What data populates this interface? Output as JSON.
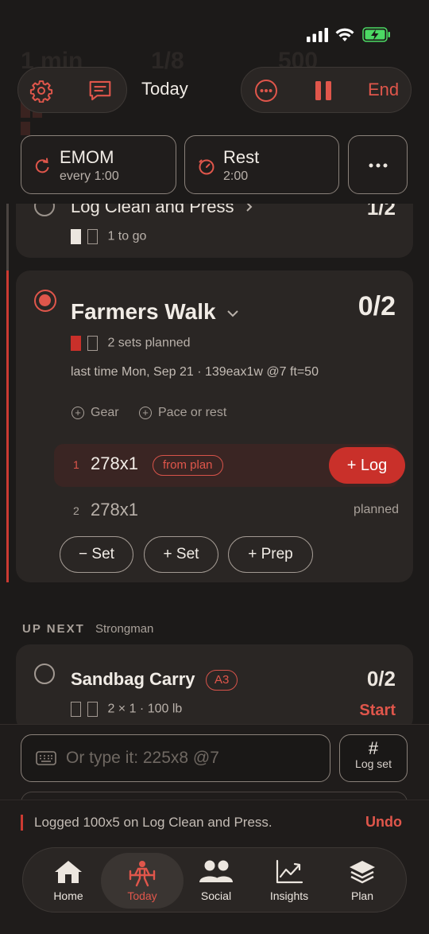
{
  "header": {
    "title": "Today",
    "end_label": "End"
  },
  "chips": {
    "emom": {
      "label": "EMOM",
      "sub": "every 1:00"
    },
    "rest": {
      "label": "Rest",
      "sub": "2:00"
    }
  },
  "previous_exercise": {
    "name": "Log Clean and Press",
    "count": "1/2",
    "sets_text": "1 to go"
  },
  "current_exercise": {
    "name": "Farmers Walk",
    "count": "0/2",
    "sets_text": "2 sets planned",
    "last_time": "last time Mon, Sep 21 · 139eax1w @7 ft=50",
    "options": [
      "Gear",
      "Pace or rest"
    ],
    "sets": [
      {
        "num": "1",
        "value": "278x1",
        "badge": "from plan",
        "action": "+ Log"
      },
      {
        "num": "2",
        "value": "278x1",
        "status": "planned"
      }
    ],
    "buttons": {
      "minus_set": "− Set",
      "plus_set": "+ Set",
      "plus_prep": "+ Prep"
    }
  },
  "up_next": {
    "heading": "UP NEXT",
    "group": "Strongman",
    "exercise": {
      "name": "Sandbag Carry",
      "tag": "A3",
      "count": "0/2",
      "meta": "2 × 1 · 100 lb",
      "action": "Start"
    }
  },
  "entry": {
    "placeholder": "Or type it: 225x8 @7",
    "log_set_symbol": "#",
    "log_set_label": "Log set"
  },
  "toast": {
    "message": "Logged 100x5 on Log Clean and Press.",
    "action": "Undo"
  },
  "tabs": [
    {
      "label": "Home",
      "icon": "home-icon"
    },
    {
      "label": "Today",
      "icon": "barbell-lifter-icon",
      "active": true
    },
    {
      "label": "Social",
      "icon": "people-icon"
    },
    {
      "label": "Insights",
      "icon": "chart-icon"
    },
    {
      "label": "Plan",
      "icon": "layers-icon"
    }
  ],
  "colors": {
    "background": "#1c1a19",
    "card": "#2a2624",
    "accent": "#e0564b",
    "accent_dark": "#c9302a"
  }
}
